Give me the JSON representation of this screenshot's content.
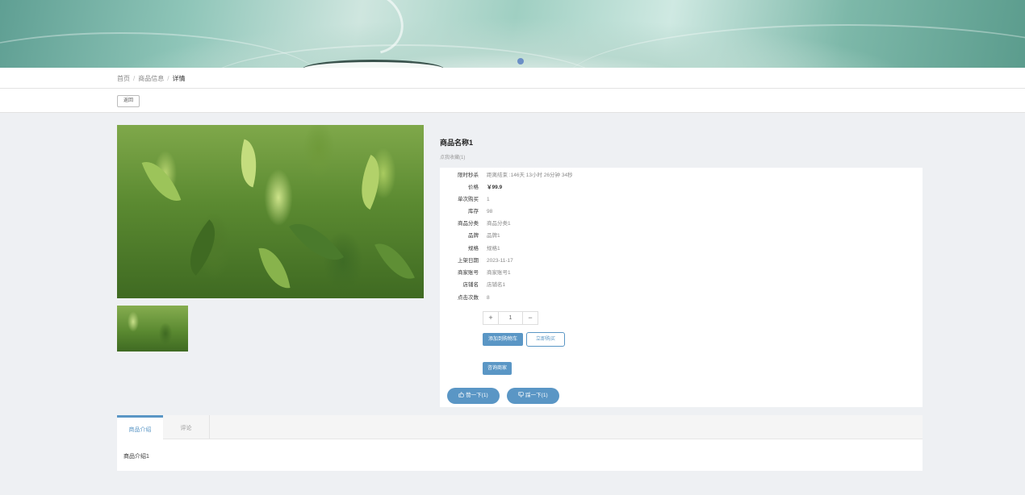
{
  "breadcrumb": {
    "home": "首页",
    "section": "商品信息",
    "current": "详情",
    "separator": "/"
  },
  "back_label": "返回",
  "product": {
    "name": "商品名称1",
    "favorite_label": "点我收藏(1)",
    "fields": [
      {
        "label": "限时秒杀",
        "value": "距离结束 :146天 13小时 26分钟 34秒"
      },
      {
        "label": "价格",
        "value": "￥99.9"
      },
      {
        "label": "单次购买",
        "value": "1"
      },
      {
        "label": "库存",
        "value": "98"
      },
      {
        "label": "商品分类",
        "value": "商品分类1"
      },
      {
        "label": "品牌",
        "value": "品牌1"
      },
      {
        "label": "规格",
        "value": "规格1"
      },
      {
        "label": "上架日期",
        "value": "2023-11-17"
      },
      {
        "label": "商家账号",
        "value": "商家账号1"
      },
      {
        "label": "店铺名",
        "value": "店铺名1"
      },
      {
        "label": "点击次数",
        "value": "8"
      }
    ]
  },
  "quantity": {
    "plus": "+",
    "value": "1",
    "minus": "−"
  },
  "buttons": {
    "add_to_cart": "添加到购物车",
    "buy_now": "立即购买",
    "consult": "咨询商家",
    "like": "赞一下(1)",
    "dislike": "踩一下(1)"
  },
  "icons": {
    "like": "thumbs-up-icon",
    "dislike": "thumbs-down-icon"
  },
  "tabs": [
    {
      "label": "商品介绍"
    },
    {
      "label": "评论"
    }
  ],
  "intro_text": "商品介绍1",
  "colors": {
    "accent": "#5a96c5",
    "background": "#eef0f3"
  }
}
